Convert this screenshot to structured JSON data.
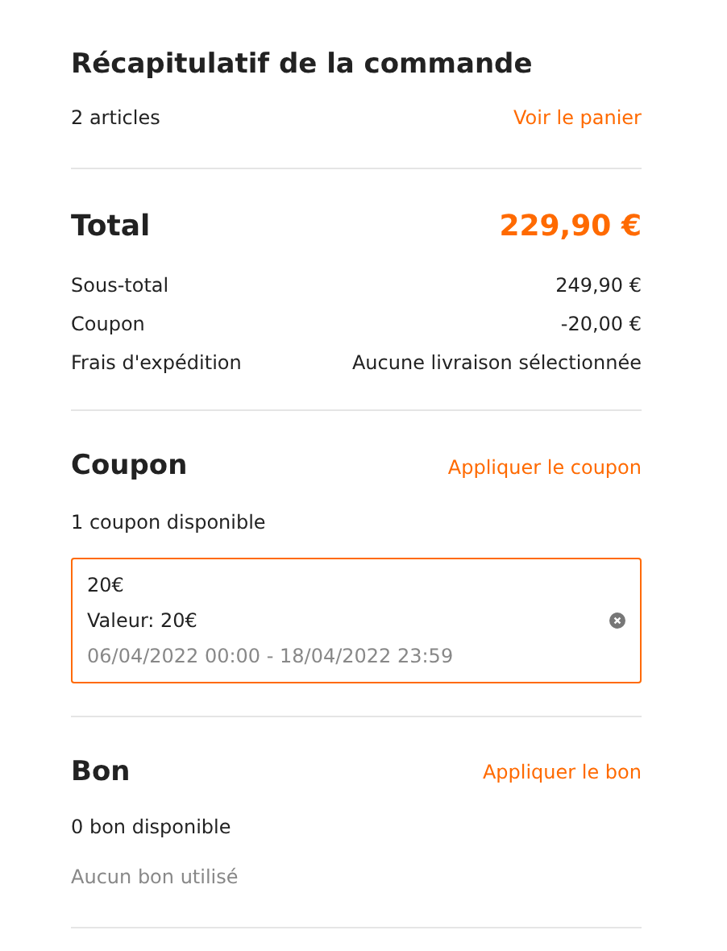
{
  "summary": {
    "title": "Récapitulatif de la commande",
    "count": "2 articles",
    "link": "Voir le panier"
  },
  "total": {
    "label": "Total",
    "value": "229,90 €",
    "lines": [
      {
        "label": "Sous-total",
        "value": "249,90 €"
      },
      {
        "label": "Coupon",
        "value": "-20,00 €"
      },
      {
        "label": "Frais d'expédition",
        "value": "Aucune livraison sélectionnée"
      }
    ]
  },
  "coupon": {
    "title": "Coupon",
    "action": "Appliquer le coupon",
    "available": "1 coupon disponible",
    "items": [
      {
        "name": "20€",
        "value": "Valeur: 20€",
        "validity": "06/04/2022 00:00 - 18/04/2022 23:59",
        "selected": true
      }
    ]
  },
  "voucher": {
    "title": "Bon",
    "action": "Appliquer le bon",
    "available": "0 bon disponible",
    "empty": "Aucun bon utilisé"
  }
}
